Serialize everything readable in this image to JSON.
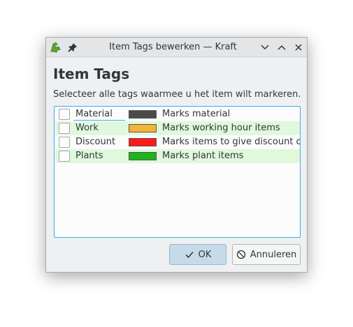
{
  "window": {
    "title": "Item Tags bewerken — Kraft"
  },
  "dialog": {
    "heading": "Item Tags",
    "instruction": "Selecteer alle tags waarmee u het item wilt markeren."
  },
  "tags": [
    {
      "name": "Material",
      "description": "Marks material",
      "color": "#4a4a4a",
      "checked": false
    },
    {
      "name": "Work",
      "description": "Marks working hour items",
      "color": "#f5b436",
      "checked": false
    },
    {
      "name": "Discount",
      "description": "Marks items to give discount on",
      "color": "#ff1a1a",
      "checked": false
    },
    {
      "name": "Plants",
      "description": "Marks plant items",
      "color": "#1db31d",
      "checked": false
    }
  ],
  "buttons": {
    "ok_label": "OK",
    "cancel_label": "Annuleren"
  },
  "icons": {
    "app": "kraft-app-icon",
    "pin": "pin-icon",
    "minimize": "chevron-down-icon",
    "maximize": "chevron-up-icon",
    "close": "close-icon",
    "ok": "checkmark-icon",
    "cancel": "cancel-icon"
  },
  "colors": {
    "accent": "#3daee9",
    "row_alt": "#e0f8dc",
    "ok_button": "#c5dbe8"
  }
}
